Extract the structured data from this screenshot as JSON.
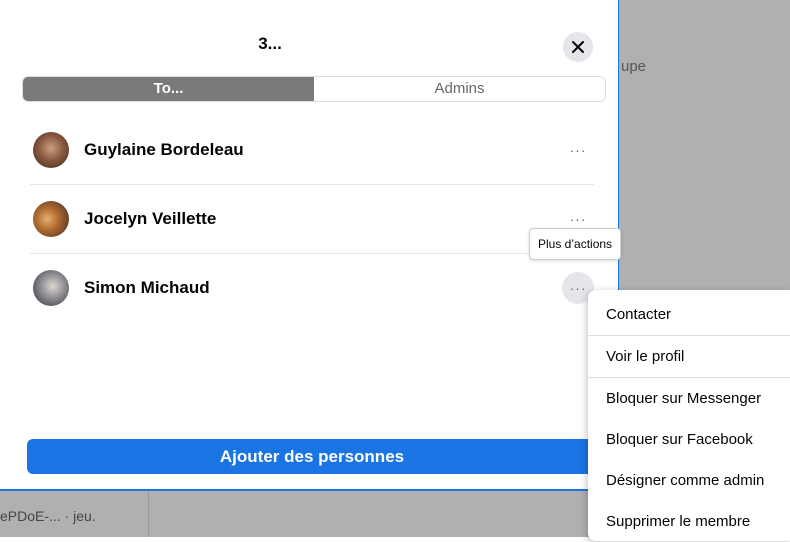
{
  "background": {
    "right_text": "upe",
    "bottom_text": "ePDoE-...  · jeu."
  },
  "dialog": {
    "title": "3...",
    "close_icon": "close-icon",
    "tabs": [
      {
        "label": "To...",
        "active": true
      },
      {
        "label": "Admins",
        "active": false
      }
    ],
    "members": [
      {
        "name": "Guylaine Bordeleau",
        "more": "···"
      },
      {
        "name": "Jocelyn Veillette",
        "more": "···"
      },
      {
        "name": "Simon Michaud",
        "more": "···"
      }
    ],
    "tooltip": "Plus d’actions",
    "add_button": "Ajouter des personnes"
  },
  "context_menu": {
    "items": [
      "Contacter",
      "Voir le profil",
      "Bloquer sur Messenger",
      "Bloquer sur Facebook",
      "Désigner comme admin",
      "Supprimer le membre"
    ]
  },
  "colors": {
    "accent": "#1b74e4",
    "overlay": "#b0b0b0"
  }
}
